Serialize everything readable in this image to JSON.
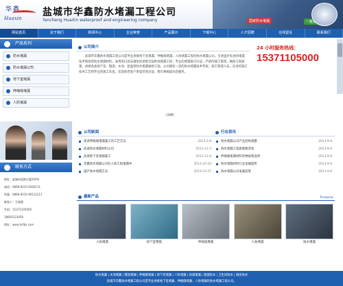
{
  "brand": {
    "logo_cn": "华鑫",
    "logo_en": "Huaxin",
    "company_cn": "盐城市华鑫防水堵漏工程公司",
    "company_en": "Yancheng HuaXin waterproof and engineering company",
    "banner_badge1": "国家防水堵漏",
    "banner_badge2": "一级资质"
  },
  "nav": [
    "网站首页",
    "关于我们",
    "新闻中心",
    "企业荣誉",
    "产品展示",
    "下载中心",
    "人才招聘",
    "在线留言",
    "联系我们"
  ],
  "sidebar": {
    "products_title": "产品系列",
    "categories": [
      "防水堵漏",
      "防水堵漏公司",
      "地下室堵漏",
      "伸缩缝堵漏",
      "人防堵漏"
    ],
    "contact_title": "联系方式",
    "contact_lines": [
      "地址：盐城市迎宾大道169号",
      "电话：0896-8315-8383111",
      "传真：0896-8315-96112111",
      "联系人：于经理",
      "手机：15371105000",
      "18850123456",
      "网址：www.hsfbs.com"
    ]
  },
  "intro": {
    "title": "公司简介",
    "text": "盐城市华鑫防水堵漏工程公司是专业承接地下室堵漏、伸缩缝堵漏、人防堵漏工程的防水堵漏公司，引进国外先进的堵漏技术和高新防水堵漏材料，采用进口高压灌浆机承接全国各地堵漏工程，专业的堵漏施工队伍，严格的施工管理，确保工程质量，承接各类地下室、隧道、水池、屋面等防水堵漏维修工程。公司拥有一流的防水堵漏技术专家，施工管理人员，先进的施工技术工艺和专业的施工队伍，欢迎新老客户来电咨询洽谈，我们将竭诚为您服务。",
    "more": "[详细]"
  },
  "hotline": {
    "label": "24 小时服务热线：",
    "number": "15371105000"
  },
  "news": {
    "title": "公司新闻",
    "items": [
      {
        "text": "简述伸缩缝堵漏施工的工艺方法",
        "date": "2013-2-8"
      },
      {
        "text": "盐城防水堵漏材料公司",
        "date": "2013-12-3"
      },
      {
        "text": "盐城地下室堵漏施工",
        "date": "2013-11-8"
      },
      {
        "text": "华鑫防水堵漏公司在人防工程堵漏中",
        "date": "2013-10-20"
      },
      {
        "text": "国产防水堵漏方法",
        "date": "2013-10-27"
      }
    ]
  },
  "industry": {
    "title": "行业资讯",
    "items": [
      {
        "text": "防水堵漏公司产业结构调整",
        "date": "2013-9-8"
      },
      {
        "text": "防水堵漏工程质量要求高",
        "date": "2013-9-8"
      },
      {
        "text": "伸缩缝堵漏材料的种类和选用",
        "date": "2013-9-8"
      },
      {
        "text": "防水堵漏材料行业发展趋势",
        "date": "2013-9-8"
      },
      {
        "text": "防水堵漏公司发展前景",
        "date": "2013-9-8"
      }
    ]
  },
  "products": {
    "title": "最新产品",
    "more": "Products",
    "items": [
      {
        "caption": "人防堵漏",
        "color1": "#6b7c8e",
        "color2": "#3a4656"
      },
      {
        "caption": "地下室堵漏",
        "color1": "#7fb1c6",
        "color2": "#2e6c86"
      },
      {
        "caption": "伸缩缝堵漏",
        "color1": "#b8bec6",
        "color2": "#6a7078"
      },
      {
        "caption": "人防堵漏",
        "color1": "#9a8f7a",
        "color2": "#4b4538"
      },
      {
        "caption": "防水堵漏",
        "color1": "#5f6f80",
        "color2": "#2c3440"
      }
    ]
  },
  "footer": {
    "line1": "防水堵漏 | 水池堵漏 | 隧道堵漏 | 伸缩缝堵漏 | 地下室堵漏 | 人防堵漏 | 盐城堵漏 | 屋面防水 | 卫生间防水 | 厨房防水",
    "line2": "盐城市华鑫防水堵漏工程公司是专业承接地下室堵漏、伸缩缝堵漏、人防堵漏的防水堵漏工程公司。"
  }
}
